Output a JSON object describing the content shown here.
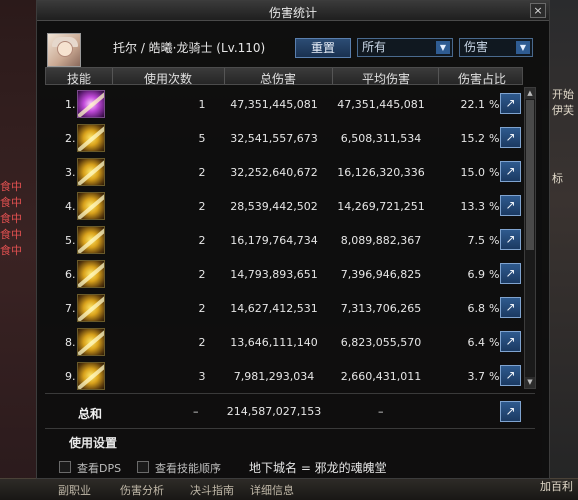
{
  "window": {
    "title": "伤害统计",
    "close_glyph": "×"
  },
  "header": {
    "character_name": "托尔 / 皓曦·龙骑士 (Lv.110)",
    "reset_label": "重置",
    "filter_scope": "所有",
    "filter_metric": "伤害"
  },
  "columns": {
    "skill": "技能",
    "count": "使用次数",
    "total": "总伤害",
    "avg": "平均伤害",
    "pct": "伤害占比"
  },
  "rows": [
    {
      "rank": "1.",
      "count": "1",
      "total": "47,351,445,081",
      "avg": "47,351,445,081",
      "pct": "22.1",
      "icon": "skill-icon-1"
    },
    {
      "rank": "2.",
      "count": "5",
      "total": "32,541,557,673",
      "avg": "6,508,311,534",
      "pct": "15.2",
      "icon": "skill-icon-2"
    },
    {
      "rank": "3.",
      "count": "2",
      "total": "32,252,640,672",
      "avg": "16,126,320,336",
      "pct": "15.0",
      "icon": "skill-icon-3"
    },
    {
      "rank": "4.",
      "count": "2",
      "total": "28,539,442,502",
      "avg": "14,269,721,251",
      "pct": "13.3",
      "icon": "skill-icon-4"
    },
    {
      "rank": "5.",
      "count": "2",
      "total": "16,179,764,734",
      "avg": "8,089,882,367",
      "pct": "7.5",
      "icon": "skill-icon-5"
    },
    {
      "rank": "6.",
      "count": "2",
      "total": "14,793,893,651",
      "avg": "7,396,946,825",
      "pct": "6.9",
      "icon": "skill-icon-6"
    },
    {
      "rank": "7.",
      "count": "2",
      "total": "14,627,412,531",
      "avg": "7,313,706,265",
      "pct": "6.8",
      "icon": "skill-icon-7"
    },
    {
      "rank": "8.",
      "count": "2",
      "total": "13,646,111,140",
      "avg": "6,823,055,570",
      "pct": "6.4",
      "icon": "skill-icon-8"
    },
    {
      "rank": "9.",
      "count": "3",
      "total": "7,981,293,034",
      "avg": "2,660,431,011",
      "pct": "3.7",
      "icon": "skill-icon-9"
    }
  ],
  "pct_sign": "%",
  "totals": {
    "label": "总和",
    "count": "–",
    "total": "214,587,027,153",
    "avg": "–"
  },
  "settings_label": "使用设置",
  "options": {
    "show_dps": "查看DPS",
    "show_order": "查看技能顺序",
    "dungeon": "地下城名 = 邪龙的魂魄堂"
  },
  "background": {
    "left_labels": [
      "食中",
      "食中",
      "食中",
      "食中",
      "食中"
    ],
    "bottom_tabs": [
      "副职业",
      "伤害分析",
      "决斗指南",
      "详细信息"
    ],
    "right_texts": [
      "开始",
      "伊芙",
      "标",
      "加百利"
    ]
  }
}
